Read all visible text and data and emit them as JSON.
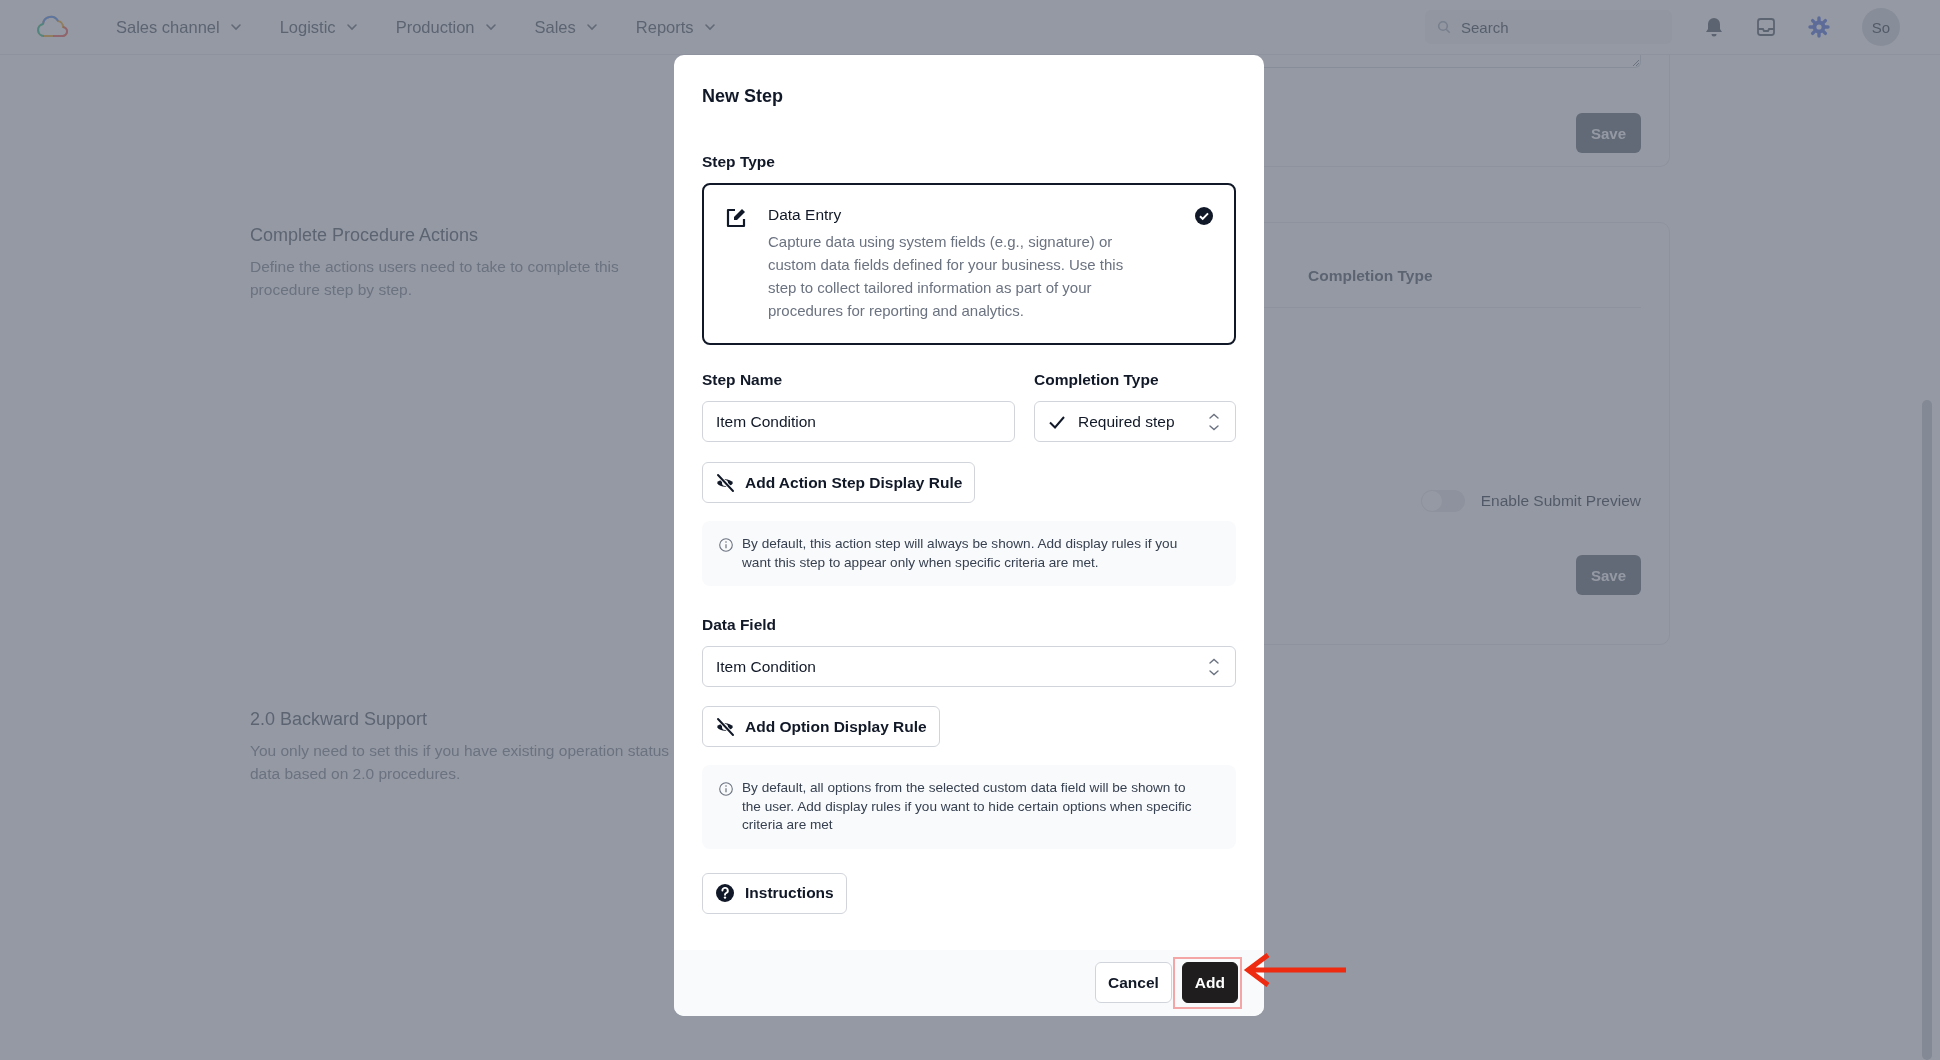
{
  "nav": {
    "menus": [
      {
        "label": "Sales channel"
      },
      {
        "label": "Logistic"
      },
      {
        "label": "Production"
      },
      {
        "label": "Sales"
      },
      {
        "label": "Reports"
      }
    ],
    "search": {
      "placeholder": "Search"
    },
    "avatar": "So"
  },
  "sections": [
    {
      "title": "Complete Procedure Actions",
      "description": "Define the actions users need to take to complete this procedure step by step."
    },
    {
      "title": "2.0 Backward Support",
      "description": "You only need to set this if you have existing operation status data based on 2.0 procedures."
    }
  ],
  "cards": [
    {
      "button": "Save"
    },
    {
      "heading": "Completion Type",
      "toggle": {
        "label": "Enable Submit Preview",
        "on": false
      },
      "button": "Save"
    }
  ],
  "dialog": {
    "title": "New Step",
    "step_type": {
      "label": "Step Type",
      "options": [
        {
          "title": "Data Entry",
          "description": "Capture data using system fields (e.g., signature) or custom data fields defined for your business. Use this step to collect tailored information as part of your procedures for reporting and analytics.",
          "selected": true
        }
      ]
    },
    "step_name": {
      "label": "Step Name",
      "value": "Item Condition"
    },
    "completion_type": {
      "label": "Completion Type",
      "value": "Required step"
    },
    "display_rule_button": "Add Action Step Display Rule",
    "display_rule_note": "By default, this action step will always be shown. Add display rules if you want this step to appear only when specific criteria are met.",
    "data_field": {
      "label": "Data Field",
      "value": "Item Condition"
    },
    "option_rule_button": "Add Option Display Rule",
    "option_rule_note": "By default, all options from the selected custom data field will be shown to the user. Add display rules if you want to hide certain options when specific criteria are met",
    "instructions_button": "Instructions",
    "buttons": [
      {
        "label": "Cancel",
        "kind": "secondary"
      },
      {
        "label": "Add",
        "kind": "primary"
      }
    ]
  }
}
